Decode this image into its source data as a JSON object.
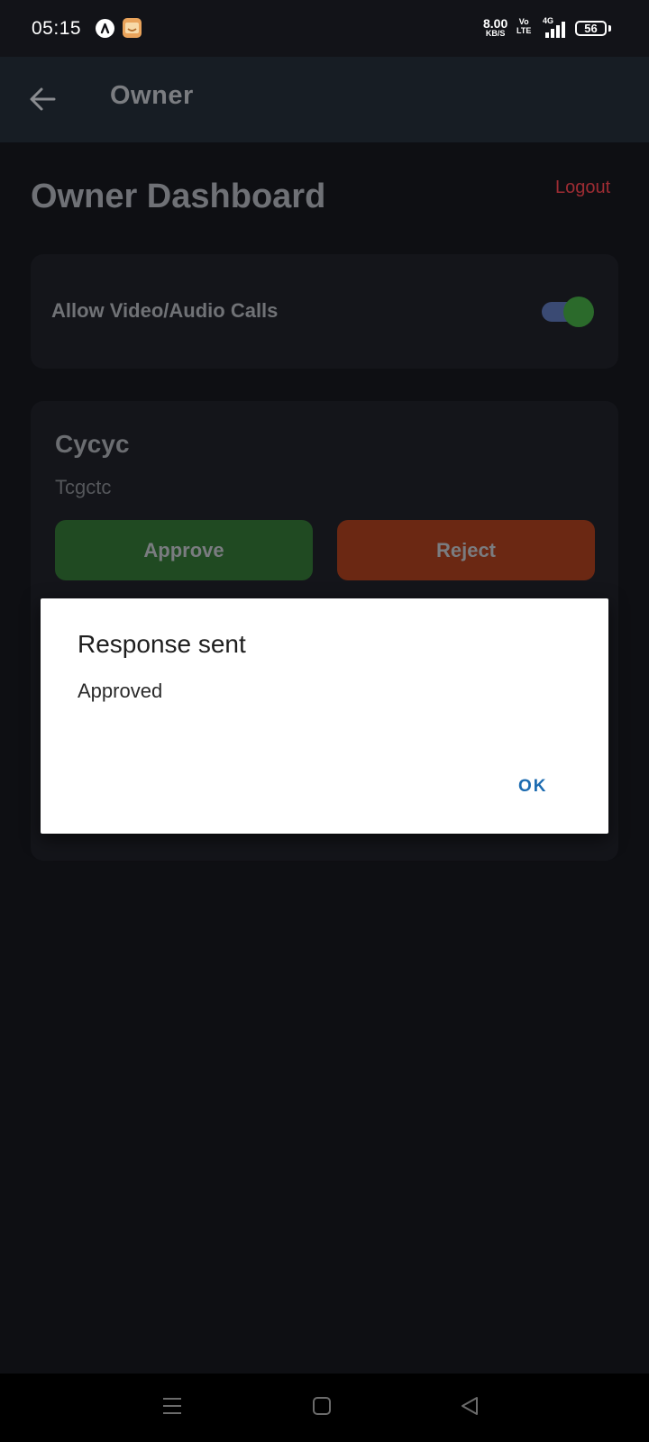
{
  "status_bar": {
    "time": "05:15",
    "speed_value": "8.00",
    "speed_unit": "KB/S",
    "volte_top": "Vo",
    "volte_bottom": "LTE",
    "network": "4G",
    "battery": "56"
  },
  "app_bar": {
    "title": "Owner",
    "back_icon": "arrow-left-icon"
  },
  "dashboard": {
    "title": "Owner Dashboard",
    "logout_label": "Logout"
  },
  "calls_setting": {
    "label": "Allow Video/Audio Calls",
    "enabled": true
  },
  "request": {
    "name": "Cycyc",
    "message": "Tcgctc",
    "approve_label": "Approve",
    "reject_label": "Reject"
  },
  "dialog": {
    "title": "Response sent",
    "message": "Approved",
    "ok_label": "OK"
  },
  "colors": {
    "background": "#0e0f13",
    "approve": "#204a22",
    "reject": "#6b2813",
    "logout": "#9d2c33",
    "dialog_button": "#1c6bb0"
  },
  "nav_bar": {
    "icons": [
      "menu-icon",
      "home-square-icon",
      "back-triangle-icon"
    ]
  }
}
